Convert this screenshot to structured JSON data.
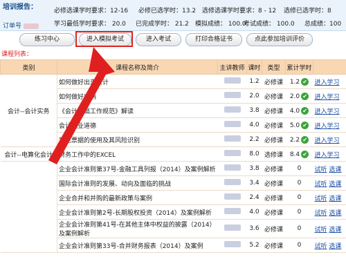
{
  "report": {
    "title": "培训报告：",
    "order_label": "订单号",
    "row1": [
      "必修选课学时要求：12-16",
      "必修已选学时：13.2",
      "选修选课学时要求：8 - 12",
      "选修已选学时：8"
    ],
    "row2": [
      "学习最低学时要求： 20.0",
      "已完成学时：  21.2",
      "模拟成绩： 100.0",
      "考试成绩： 100.0",
      "总成绩：100"
    ]
  },
  "buttons": [
    "练习中心",
    "进入模拟考试",
    "进入考试",
    "打印合格证书",
    "点此参加培训评价"
  ],
  "list_label": "课程列表：",
  "table": {
    "headers": [
      "类别",
      "课程名称及简介",
      "主讲教师",
      "课时",
      "类型",
      "累计学时",
      ""
    ],
    "categories": [
      "会计--会计实务",
      "会计--电算化会计"
    ],
    "rows": [
      {
        "name": "如何做好出来会计",
        "hours": "1.2",
        "type": "必修课",
        "done": "1.2",
        "links": [
          "进入学习"
        ]
      },
      {
        "name": "如何做好出纳",
        "hours": "2.0",
        "type": "必修课",
        "done": "2.0",
        "links": [
          "进入学习"
        ]
      },
      {
        "name": "《会计基础工作规范》解读",
        "hours": "3.8",
        "type": "必修课",
        "done": "4.0",
        "links": [
          "进入学习"
        ]
      },
      {
        "name": "会计职业道德",
        "hours": "4.0",
        "type": "必修课",
        "done": "5.0",
        "links": [
          "进入学习"
        ]
      },
      {
        "name": "常见票据的使用及其风险识别",
        "hours": "2.2",
        "type": "必修课",
        "done": "2.2",
        "links": [
          "进入学习"
        ]
      },
      {
        "name": "财务工作中的EXCEL",
        "hours": "8.0",
        "type": "选修课",
        "done": "8.4",
        "links": [
          "进入学习"
        ]
      },
      {
        "name": "企业会计准则第37号-金融工具列报（2014）及案例解析",
        "hours": "3.8",
        "type": "必修课",
        "done": "0",
        "links": [
          "试听",
          "选课"
        ]
      },
      {
        "name": "国际会计准则的发展、动向及面临的挑战",
        "hours": "3.4",
        "type": "必修课",
        "done": "0",
        "links": [
          "试听",
          "选课"
        ]
      },
      {
        "name": "企业合并和并购的最新政策与案例",
        "hours": "2.4",
        "type": "必修课",
        "done": "0",
        "links": [
          "试听",
          "选课"
        ]
      },
      {
        "name": "企业会计准则第2号-长期股权投资（2014）及案例解析",
        "hours": "4.0",
        "type": "必修课",
        "done": "0",
        "links": [
          "试听",
          "选课"
        ]
      },
      {
        "name": "企业会计准则第41号-在其他主体中权益的披露（2014）及案例解析",
        "hours": "3.6",
        "type": "必修课",
        "done": "0",
        "links": [
          "试听",
          "选课"
        ]
      },
      {
        "name": "企业会计准则第33号-合并财务报表（2014）及案例",
        "hours": "5.2",
        "type": "必修课",
        "done": "0",
        "links": [
          "试听",
          "选课"
        ]
      }
    ]
  },
  "colors": {
    "highlight": "#e02020",
    "header_bg": "#f9d7b3",
    "link": "#1a4ea3",
    "check": "#3aa53a"
  }
}
